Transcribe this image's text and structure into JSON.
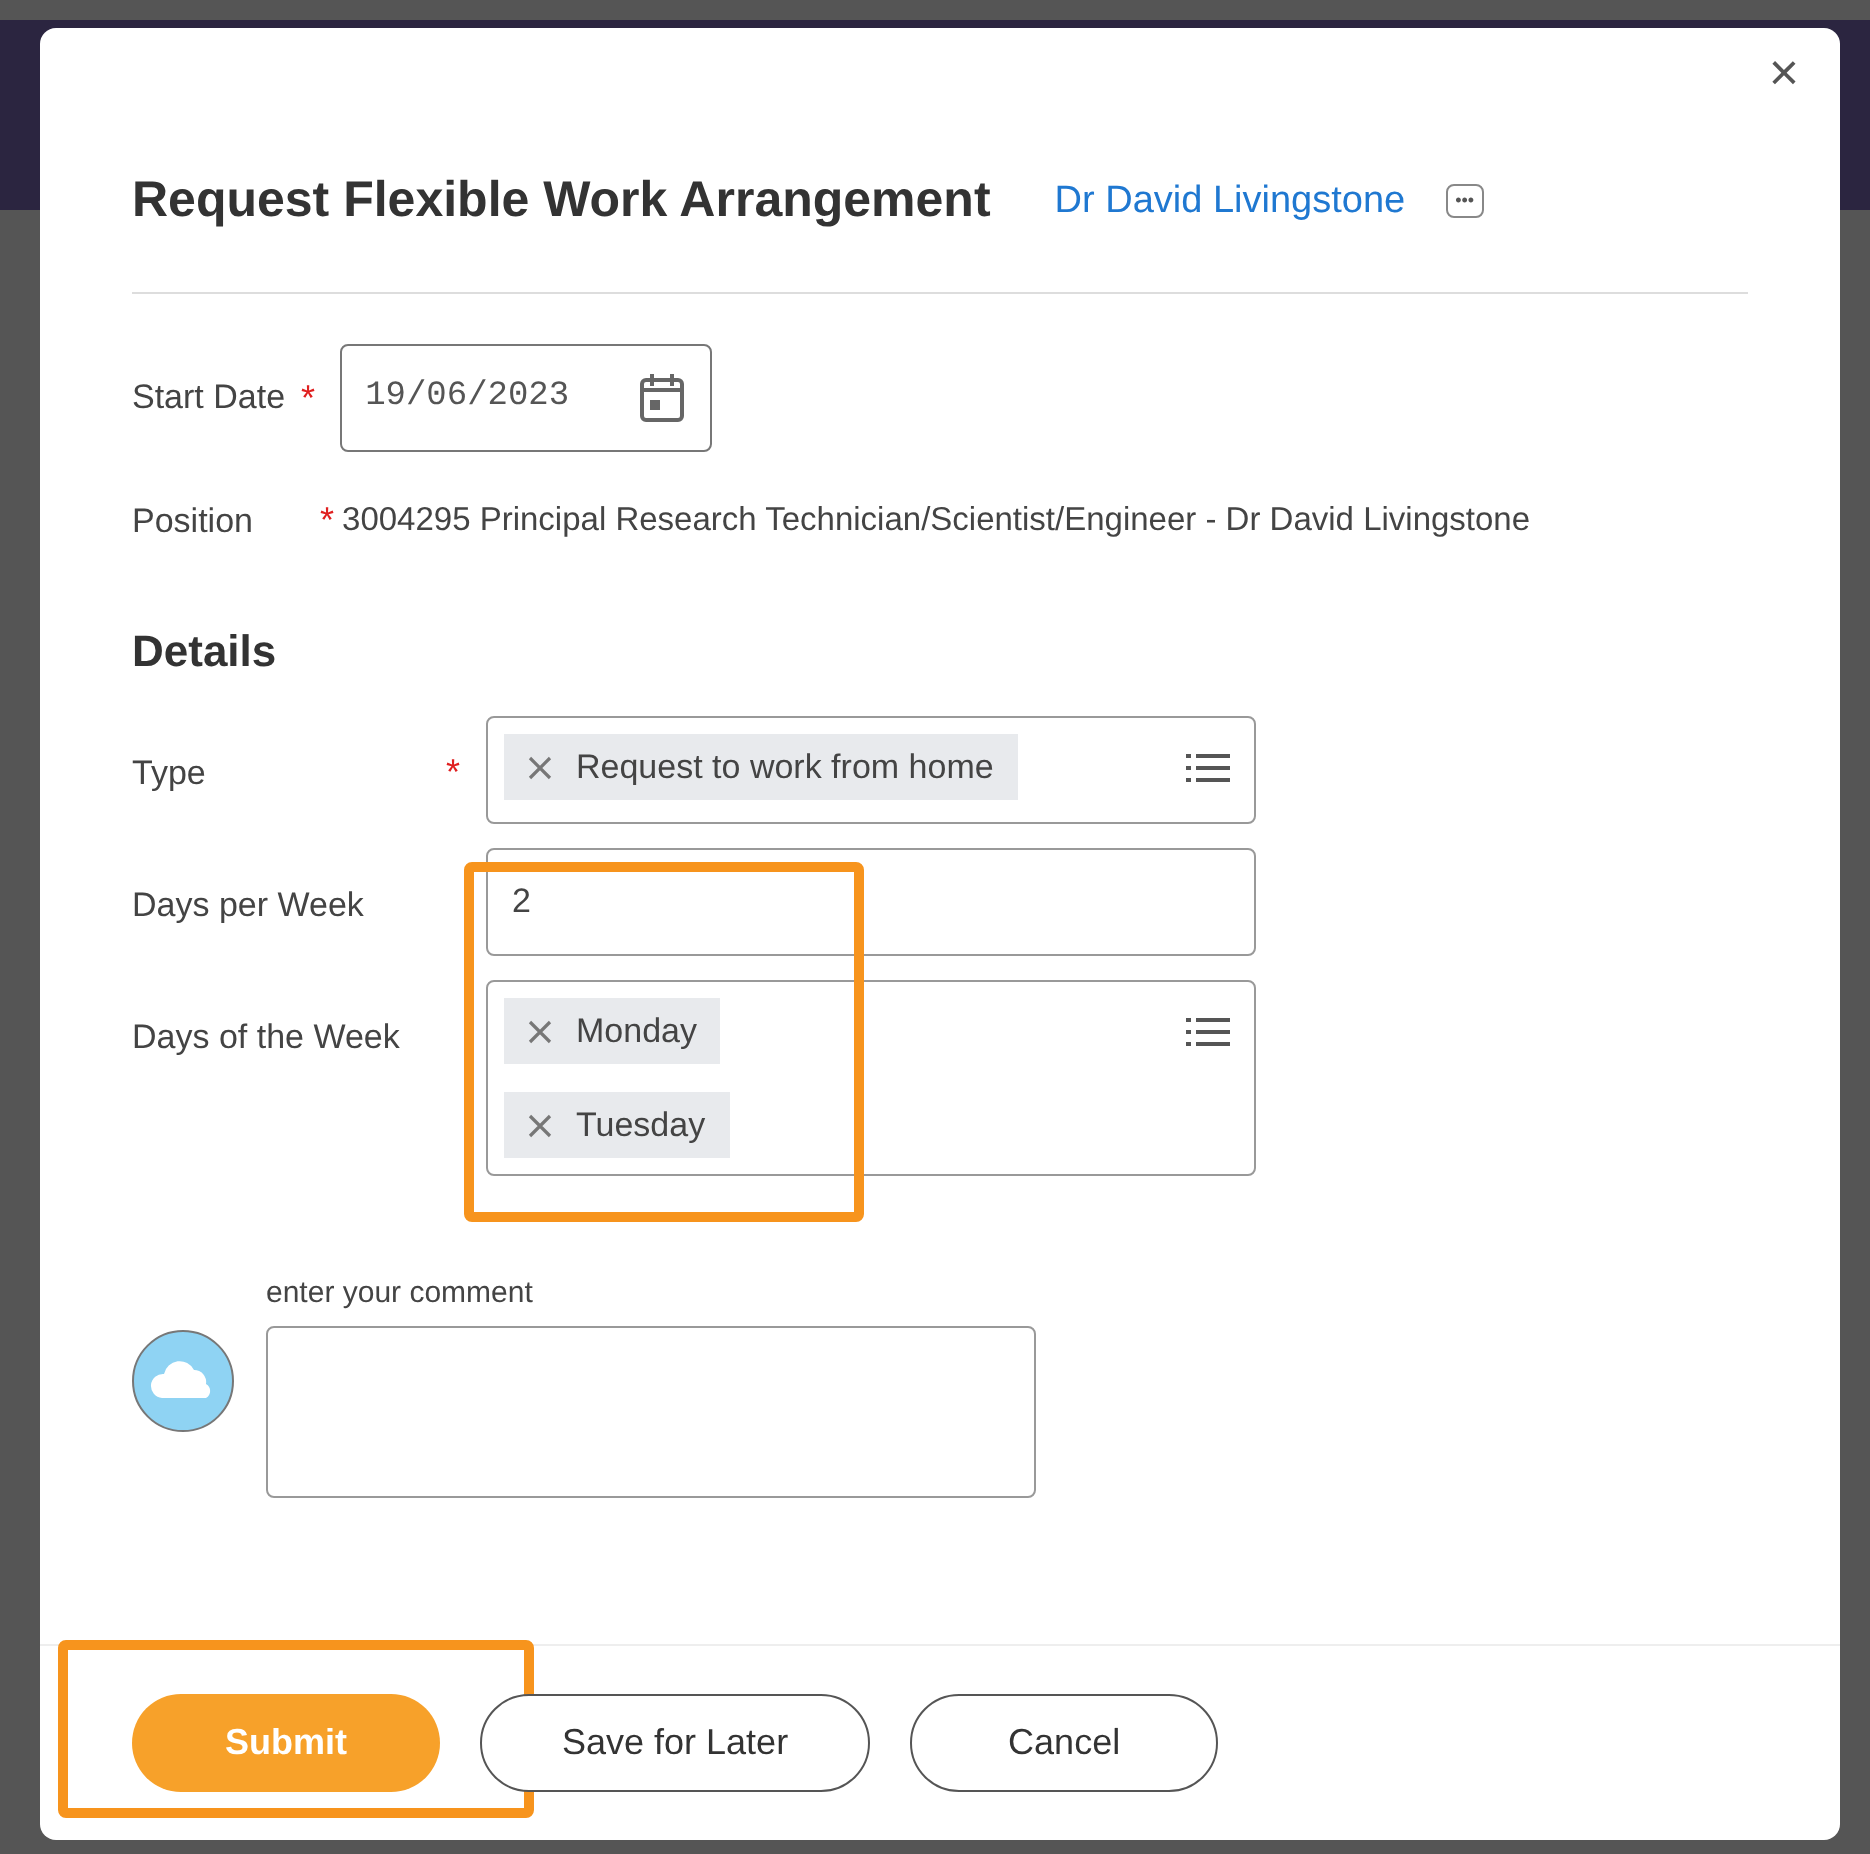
{
  "dialog": {
    "title": "Request Flexible Work Arrangement",
    "worker_link": "Dr David Livingstone",
    "more_button": "•••",
    "close_button": "×"
  },
  "start_date": {
    "label": "Start Date",
    "required_mark": "*",
    "value": "19/06/2023"
  },
  "position": {
    "label": "Position",
    "required_mark": "*",
    "value": "3004295 Principal Research Technician/Scientist/Engineer - Dr David Livingstone"
  },
  "details": {
    "heading": "Details",
    "fields": [
      {
        "kind": "tags",
        "label": "Type",
        "required_mark": "*",
        "tags": [
          "Request to work from home"
        ],
        "highlighted": false
      },
      {
        "kind": "text",
        "label": "Days per Week",
        "value": "2",
        "highlighted": true
      },
      {
        "kind": "tags",
        "label": "Days of the Week",
        "tags": [
          "Monday",
          "Tuesday"
        ],
        "highlighted": true
      }
    ]
  },
  "comment": {
    "label": "enter your comment"
  },
  "buttons": [
    {
      "label": "Submit",
      "kind": "primary",
      "highlighted": true
    },
    {
      "label": "Save for Later",
      "kind": "secondary",
      "highlighted": false
    },
    {
      "label": "Cancel",
      "kind": "secondary",
      "highlighted": false
    }
  ]
}
